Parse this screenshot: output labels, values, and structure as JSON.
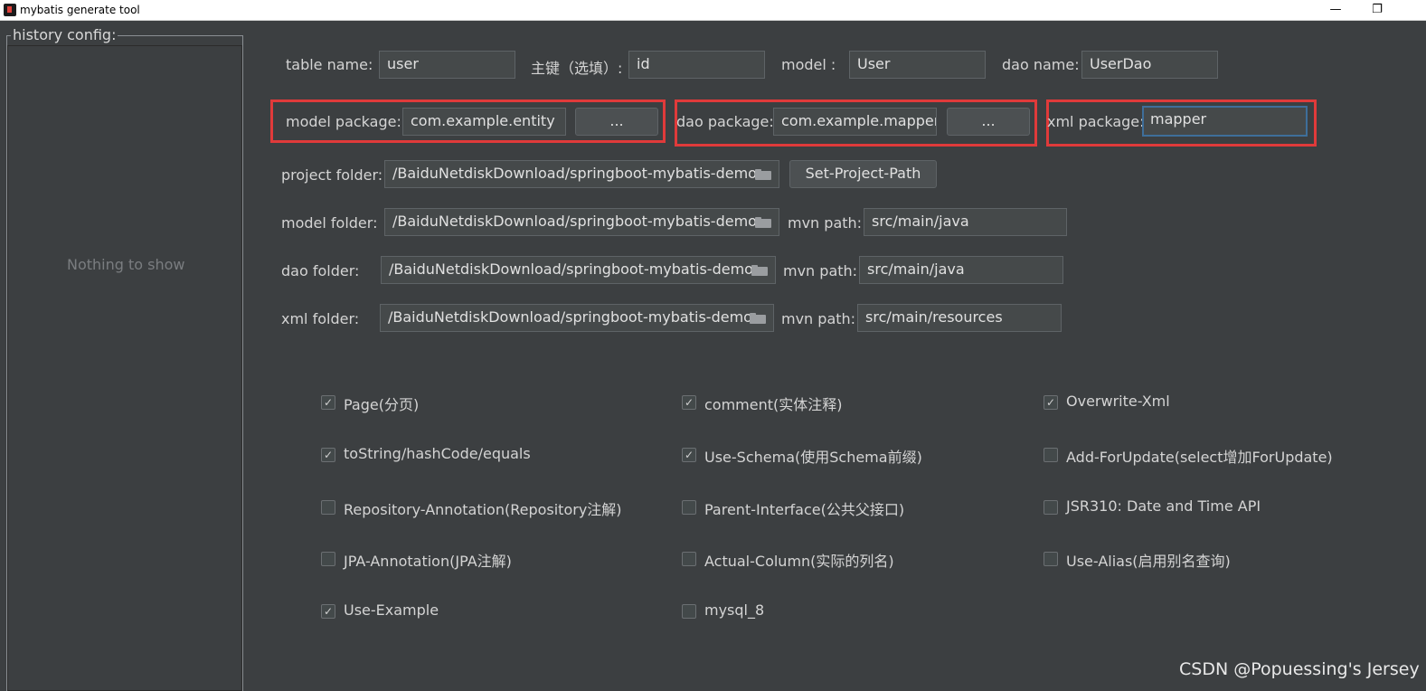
{
  "window": {
    "title": "mybatis generate tool",
    "minimize_glyph": "—",
    "restore_glyph": "❐"
  },
  "history": {
    "legend": "history config:",
    "empty_text": "Nothing to show"
  },
  "row1": {
    "table_name_label": "table  name:",
    "table_name_value": "user",
    "primary_key_label": "主键（选填）:",
    "primary_key_value": "id",
    "model_label": "model   :",
    "model_value": "User",
    "dao_name_label": "dao name:",
    "dao_name_value": "UserDao"
  },
  "row2": {
    "model_package_label": "model package:",
    "model_package_value": "com.example.entity",
    "model_package_browse": "...",
    "dao_package_label": "dao package:",
    "dao_package_value": "com.example.mapper",
    "dao_package_browse": "...",
    "xml_package_label": "xml package:",
    "xml_package_value": "mapper"
  },
  "project_folder": {
    "label": "project folder:",
    "value": "/BaiduNetdiskDownload/springboot-mybatis-demo",
    "button": "Set-Project-Path"
  },
  "model_folder": {
    "label": "model  folder:",
    "value": "/BaiduNetdiskDownload/springboot-mybatis-demo",
    "mvn_label": "mvn path:",
    "mvn_value": "src/main/java"
  },
  "dao_folder": {
    "label": "dao     folder:",
    "value": "/BaiduNetdiskDownload/springboot-mybatis-demo",
    "mvn_label": "mvn path:",
    "mvn_value": "src/main/java"
  },
  "xml_folder": {
    "label": "xml     folder:",
    "value": "/BaiduNetdiskDownload/springboot-mybatis-demo",
    "mvn_label": "mvn path:",
    "mvn_value": "src/main/resources"
  },
  "options": [
    {
      "label": "Page(分页)",
      "checked": true
    },
    {
      "label": "comment(实体注释)",
      "checked": true
    },
    {
      "label": "Overwrite-Xml",
      "checked": true
    },
    {
      "label": "toString/hashCode/equals",
      "checked": true
    },
    {
      "label": "Use-Schema(使用Schema前缀)",
      "checked": true
    },
    {
      "label": "Add-ForUpdate(select增加ForUpdate)",
      "checked": false
    },
    {
      "label": "Repository-Annotation(Repository注解)",
      "checked": false
    },
    {
      "label": "Parent-Interface(公共父接口)",
      "checked": false
    },
    {
      "label": "JSR310: Date and Time API",
      "checked": false
    },
    {
      "label": "JPA-Annotation(JPA注解)",
      "checked": false
    },
    {
      "label": "Actual-Column(实际的列名)",
      "checked": false
    },
    {
      "label": "Use-Alias(启用别名查询)",
      "checked": false
    },
    {
      "label": "Use-Example",
      "checked": true
    },
    {
      "label": "mysql_8",
      "checked": false
    }
  ],
  "watermark": "CSDN @Popuessing's Jersey"
}
